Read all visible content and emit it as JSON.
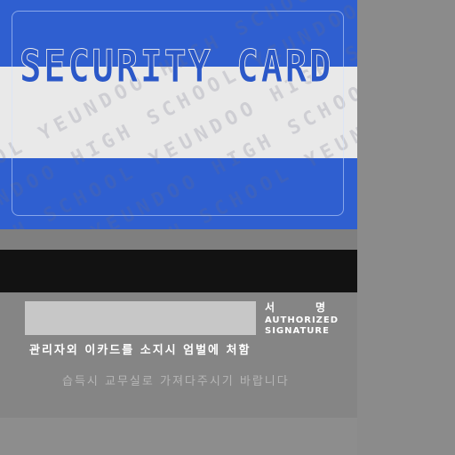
{
  "card": {
    "title": "SECURITY CARD",
    "watermark_lines": [
      "SCHOOL YEUNDOO HIGH SCHOOL YEUNDOO",
      "YEUNDOO HIGH SCHOOL YEUNDOO HIGH SCHOOL",
      "HIGH SCHOOL YEUNDOO HIGH SCHOOL YEUNDOO",
      "SCHOOL YEUNDOO HIGH SCHOOL YEUNDOO HIGH",
      "YEUNDOO HIGH SCHOOL YEUNDOO HIGH SCHOOL"
    ]
  },
  "back": {
    "signature_label_ko_1": "서",
    "signature_label_ko_2": "명",
    "signature_label_en_1": "AUTHORIZED",
    "signature_label_en_2": "SIGNATURE",
    "warning": "관리자외 이카드를 소지시 엄벌에 처함",
    "notice": "습득시 교무실로 가져다주시기 바랍니다"
  },
  "colors": {
    "card_blue": "#2f5fd0",
    "band_white": "#e9e9e9",
    "stripe_black": "#121212",
    "signature_box": "#c7c7c7"
  }
}
